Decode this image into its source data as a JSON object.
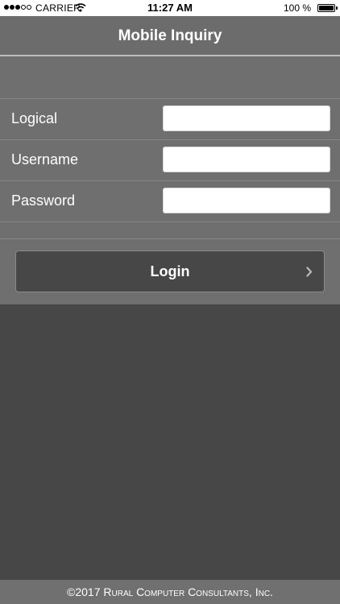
{
  "status_bar": {
    "carrier": "CARRIER",
    "time": "11:27 AM",
    "battery": "100 %",
    "signal_bars_filled": 3,
    "signal_bars_total": 5
  },
  "header": {
    "title": "Mobile Inquiry"
  },
  "form": {
    "logical": {
      "label": "Logical",
      "value": ""
    },
    "username": {
      "label": "Username",
      "value": ""
    },
    "password": {
      "label": "Password",
      "value": ""
    }
  },
  "login_button": {
    "label": "Login",
    "icon": "chevron-right-icon"
  },
  "footer": {
    "copyright": "©2017 Rural Computer Consultants, Inc."
  },
  "colors": {
    "header_bg": "#6c6c6c",
    "panel_bg": "#6f6f6f",
    "body_bg": "#474747",
    "footer_bg": "#707070",
    "text": "#ffffff"
  }
}
